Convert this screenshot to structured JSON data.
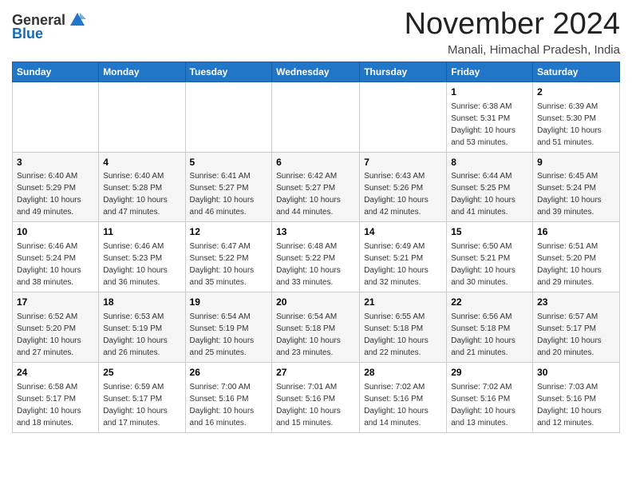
{
  "logo": {
    "general": "General",
    "blue": "Blue"
  },
  "header": {
    "month": "November 2024",
    "location": "Manali, Himachal Pradesh, India"
  },
  "weekdays": [
    "Sunday",
    "Monday",
    "Tuesday",
    "Wednesday",
    "Thursday",
    "Friday",
    "Saturday"
  ],
  "weeks": [
    [
      {
        "day": "",
        "info": ""
      },
      {
        "day": "",
        "info": ""
      },
      {
        "day": "",
        "info": ""
      },
      {
        "day": "",
        "info": ""
      },
      {
        "day": "",
        "info": ""
      },
      {
        "day": "1",
        "info": "Sunrise: 6:38 AM\nSunset: 5:31 PM\nDaylight: 10 hours and 53 minutes."
      },
      {
        "day": "2",
        "info": "Sunrise: 6:39 AM\nSunset: 5:30 PM\nDaylight: 10 hours and 51 minutes."
      }
    ],
    [
      {
        "day": "3",
        "info": "Sunrise: 6:40 AM\nSunset: 5:29 PM\nDaylight: 10 hours and 49 minutes."
      },
      {
        "day": "4",
        "info": "Sunrise: 6:40 AM\nSunset: 5:28 PM\nDaylight: 10 hours and 47 minutes."
      },
      {
        "day": "5",
        "info": "Sunrise: 6:41 AM\nSunset: 5:27 PM\nDaylight: 10 hours and 46 minutes."
      },
      {
        "day": "6",
        "info": "Sunrise: 6:42 AM\nSunset: 5:27 PM\nDaylight: 10 hours and 44 minutes."
      },
      {
        "day": "7",
        "info": "Sunrise: 6:43 AM\nSunset: 5:26 PM\nDaylight: 10 hours and 42 minutes."
      },
      {
        "day": "8",
        "info": "Sunrise: 6:44 AM\nSunset: 5:25 PM\nDaylight: 10 hours and 41 minutes."
      },
      {
        "day": "9",
        "info": "Sunrise: 6:45 AM\nSunset: 5:24 PM\nDaylight: 10 hours and 39 minutes."
      }
    ],
    [
      {
        "day": "10",
        "info": "Sunrise: 6:46 AM\nSunset: 5:24 PM\nDaylight: 10 hours and 38 minutes."
      },
      {
        "day": "11",
        "info": "Sunrise: 6:46 AM\nSunset: 5:23 PM\nDaylight: 10 hours and 36 minutes."
      },
      {
        "day": "12",
        "info": "Sunrise: 6:47 AM\nSunset: 5:22 PM\nDaylight: 10 hours and 35 minutes."
      },
      {
        "day": "13",
        "info": "Sunrise: 6:48 AM\nSunset: 5:22 PM\nDaylight: 10 hours and 33 minutes."
      },
      {
        "day": "14",
        "info": "Sunrise: 6:49 AM\nSunset: 5:21 PM\nDaylight: 10 hours and 32 minutes."
      },
      {
        "day": "15",
        "info": "Sunrise: 6:50 AM\nSunset: 5:21 PM\nDaylight: 10 hours and 30 minutes."
      },
      {
        "day": "16",
        "info": "Sunrise: 6:51 AM\nSunset: 5:20 PM\nDaylight: 10 hours and 29 minutes."
      }
    ],
    [
      {
        "day": "17",
        "info": "Sunrise: 6:52 AM\nSunset: 5:20 PM\nDaylight: 10 hours and 27 minutes."
      },
      {
        "day": "18",
        "info": "Sunrise: 6:53 AM\nSunset: 5:19 PM\nDaylight: 10 hours and 26 minutes."
      },
      {
        "day": "19",
        "info": "Sunrise: 6:54 AM\nSunset: 5:19 PM\nDaylight: 10 hours and 25 minutes."
      },
      {
        "day": "20",
        "info": "Sunrise: 6:54 AM\nSunset: 5:18 PM\nDaylight: 10 hours and 23 minutes."
      },
      {
        "day": "21",
        "info": "Sunrise: 6:55 AM\nSunset: 5:18 PM\nDaylight: 10 hours and 22 minutes."
      },
      {
        "day": "22",
        "info": "Sunrise: 6:56 AM\nSunset: 5:18 PM\nDaylight: 10 hours and 21 minutes."
      },
      {
        "day": "23",
        "info": "Sunrise: 6:57 AM\nSunset: 5:17 PM\nDaylight: 10 hours and 20 minutes."
      }
    ],
    [
      {
        "day": "24",
        "info": "Sunrise: 6:58 AM\nSunset: 5:17 PM\nDaylight: 10 hours and 18 minutes."
      },
      {
        "day": "25",
        "info": "Sunrise: 6:59 AM\nSunset: 5:17 PM\nDaylight: 10 hours and 17 minutes."
      },
      {
        "day": "26",
        "info": "Sunrise: 7:00 AM\nSunset: 5:16 PM\nDaylight: 10 hours and 16 minutes."
      },
      {
        "day": "27",
        "info": "Sunrise: 7:01 AM\nSunset: 5:16 PM\nDaylight: 10 hours and 15 minutes."
      },
      {
        "day": "28",
        "info": "Sunrise: 7:02 AM\nSunset: 5:16 PM\nDaylight: 10 hours and 14 minutes."
      },
      {
        "day": "29",
        "info": "Sunrise: 7:02 AM\nSunset: 5:16 PM\nDaylight: 10 hours and 13 minutes."
      },
      {
        "day": "30",
        "info": "Sunrise: 7:03 AM\nSunset: 5:16 PM\nDaylight: 10 hours and 12 minutes."
      }
    ]
  ]
}
